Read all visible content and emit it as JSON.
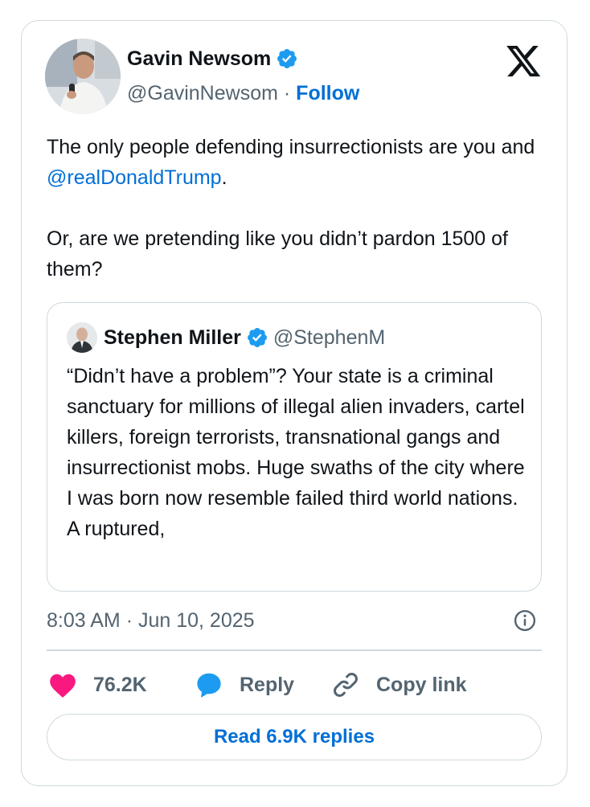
{
  "author": {
    "name": "Gavin Newsom",
    "handle": "@GavinNewsom",
    "separator": "·",
    "follow_label": "Follow"
  },
  "tweet": {
    "line1_prefix": "The only people defending insurrectionists are you and ",
    "mention": "@realDonaldTrump",
    "line1_suffix": ".",
    "paragraph2": "Or, are we pretending like you didn’t pardon 1500 of them?"
  },
  "quoted": {
    "name": "Stephen Miller",
    "handle": "@StephenM",
    "text": "“Didn’t have a problem”? Your state is a criminal sanctuary for millions of illegal alien invaders, cartel killers, foreign terrorists, transnational gangs and insurrectionist mobs. Huge swaths of the city where I was born now resemble failed third world nations. A ruptured,"
  },
  "meta": {
    "time": "8:03 AM",
    "separator": "·",
    "date": "Jun 10, 2025"
  },
  "actions": {
    "likes": "76.2K",
    "reply_label": "Reply",
    "copy_label": "Copy link"
  },
  "read_replies_label": "Read 6.9K replies",
  "icons": {
    "verified": "verified-badge-icon",
    "platform": "x-logo-icon",
    "info": "info-icon",
    "like": "heart-icon",
    "reply": "speech-bubble-icon",
    "copy": "link-icon"
  },
  "colors": {
    "link_blue": "#006fd6",
    "verified_blue": "#1d9bf0",
    "heart_pink": "#f91880",
    "muted_text": "#536471",
    "border": "#cfd9de"
  }
}
